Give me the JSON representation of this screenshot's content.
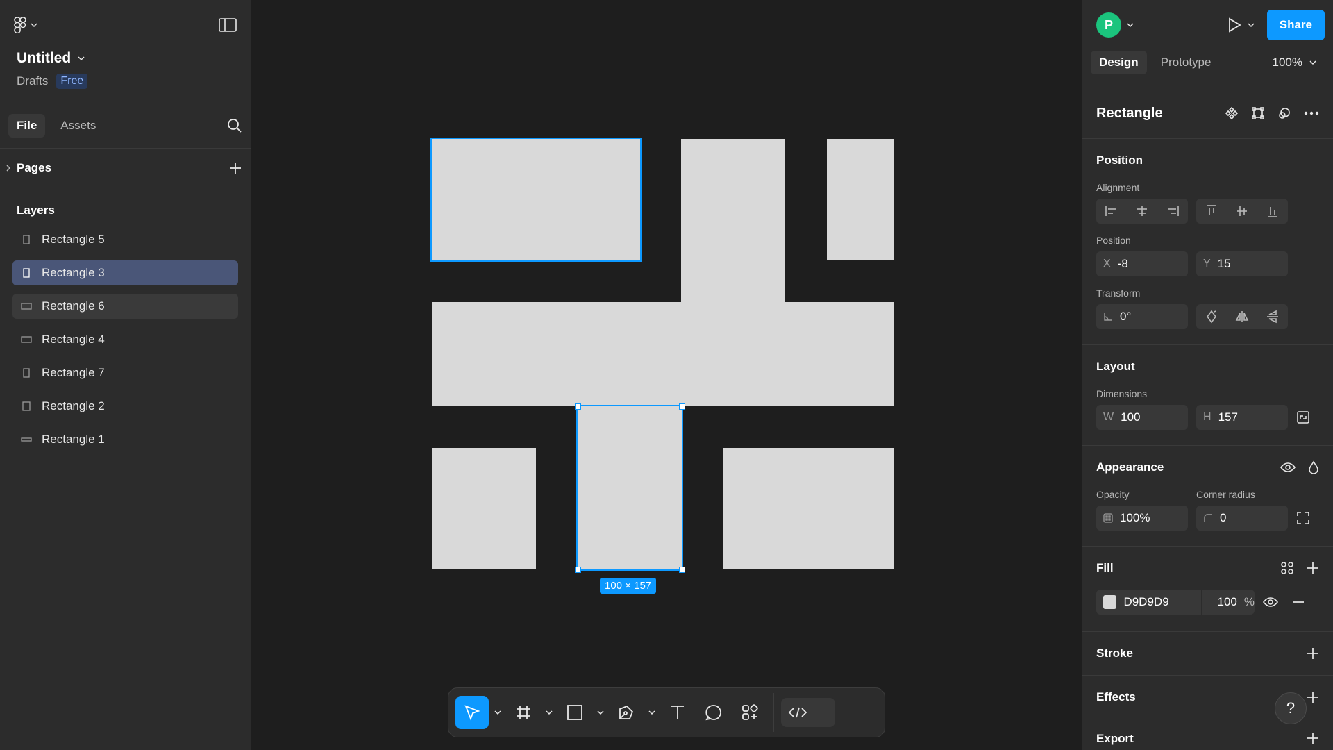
{
  "file": {
    "title": "Untitled",
    "location": "Drafts",
    "plan_badge": "Free"
  },
  "left_tabs": {
    "file": "File",
    "assets": "Assets"
  },
  "pages": {
    "label": "Pages"
  },
  "layers": {
    "heading": "Layers",
    "items": [
      {
        "label": "Rectangle 5",
        "state": "normal"
      },
      {
        "label": "Rectangle 3",
        "state": "selected"
      },
      {
        "label": "Rectangle 6",
        "state": "hover"
      },
      {
        "label": "Rectangle 4",
        "state": "normal"
      },
      {
        "label": "Rectangle 7",
        "state": "normal"
      },
      {
        "label": "Rectangle 2",
        "state": "normal"
      },
      {
        "label": "Rectangle 1",
        "state": "normal"
      }
    ]
  },
  "canvas": {
    "selection_size": "100 × 157",
    "fill_color": "#d9d9d9",
    "selection_color": "#0d99ff"
  },
  "header": {
    "avatar_initial": "P",
    "share_label": "Share"
  },
  "right_tabs": {
    "design": "Design",
    "prototype": "Prototype",
    "zoom": "100%"
  },
  "inspector": {
    "title": "Rectangle",
    "position": {
      "heading": "Position",
      "alignment_label": "Alignment",
      "position_label": "Position",
      "x_prefix": "X",
      "x": "-8",
      "y_prefix": "Y",
      "y": "15",
      "transform_label": "Transform",
      "rotation": "0°"
    },
    "layout": {
      "heading": "Layout",
      "dimensions_label": "Dimensions",
      "w_prefix": "W",
      "w": "100",
      "h_prefix": "H",
      "h": "157"
    },
    "appearance": {
      "heading": "Appearance",
      "opacity_label": "Opacity",
      "opacity": "100%",
      "radius_label": "Corner radius",
      "radius": "0"
    },
    "fill": {
      "heading": "Fill",
      "hex": "D9D9D9",
      "opacity": "100",
      "unit": "%"
    },
    "stroke": {
      "heading": "Stroke"
    },
    "effects": {
      "heading": "Effects"
    },
    "export": {
      "heading": "Export"
    }
  },
  "help": {
    "label": "?"
  }
}
